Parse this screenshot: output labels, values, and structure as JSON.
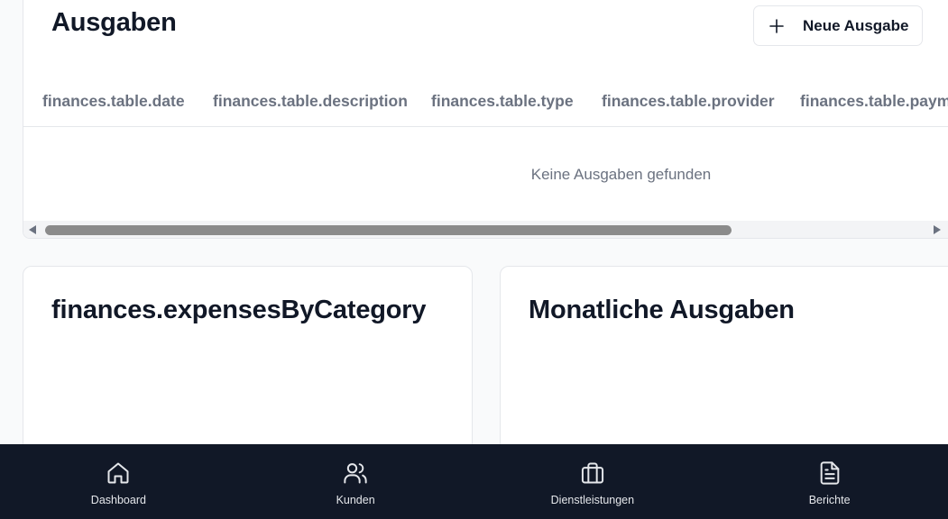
{
  "expenses": {
    "title": "Ausgaben",
    "new_button_label": "Neue Ausgabe",
    "columns": [
      "finances.table.date",
      "finances.table.description",
      "finances.table.type",
      "finances.table.provider",
      "finances.table.paymentMethod"
    ],
    "empty_message": "Keine Ausgaben gefunden"
  },
  "charts": {
    "by_category_title": "finances.expensesByCategory",
    "monthly_title": "Monatliche Ausgaben"
  },
  "nav": {
    "items": [
      {
        "label": "Dashboard",
        "icon": "home-icon"
      },
      {
        "label": "Kunden",
        "icon": "users-icon"
      },
      {
        "label": "Dienstleistungen",
        "icon": "briefcase-icon"
      },
      {
        "label": "Berichte",
        "icon": "file-text-icon"
      }
    ]
  }
}
